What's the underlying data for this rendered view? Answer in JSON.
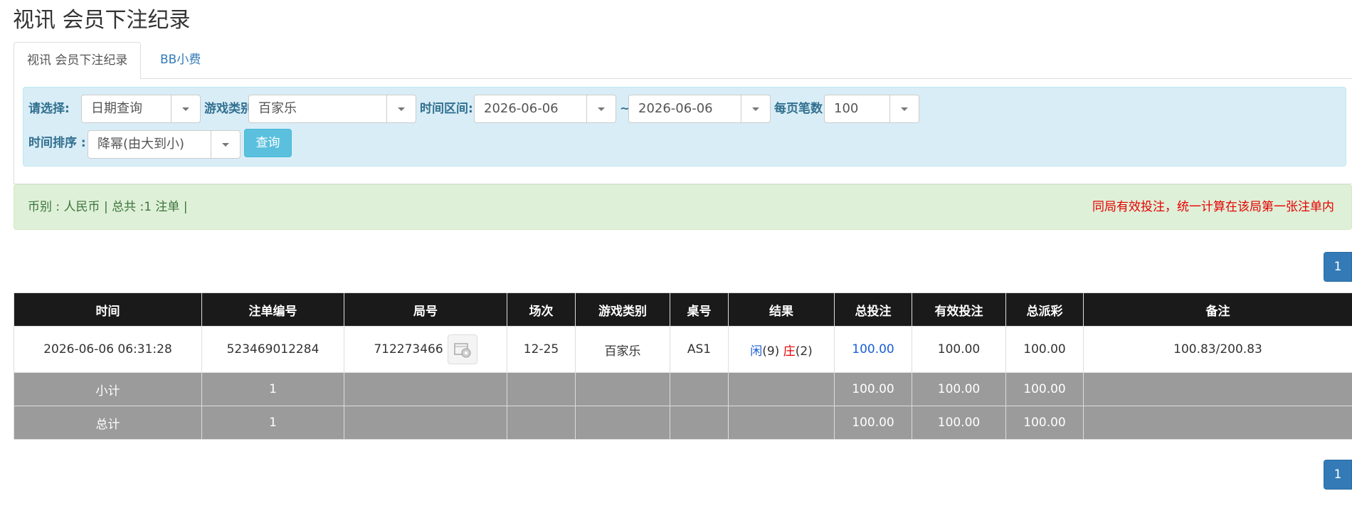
{
  "page": {
    "title": "视讯 会员下注纪录"
  },
  "tabs": [
    {
      "label": "视讯 会员下注纪录",
      "active": true
    },
    {
      "label": "BB小费",
      "active": false
    }
  ],
  "filters": {
    "select_label": "请选择:",
    "select_value": "日期查询",
    "game_type_label": "游戏类别",
    "game_type_value": "百家乐",
    "time_range_label": "时间区间:",
    "date_from": "2026-06-06",
    "tilde": "~",
    "date_to": "2026-06-06",
    "page_size_label": "每页笔数 :",
    "page_size_value": "100",
    "sort_label": "时间排序 :",
    "sort_value": "降幂(由大到小)",
    "query_button": "查询"
  },
  "summary": {
    "currency_info": "币别 : 人民币 | 总共 :1 注单 |",
    "notice": "同局有效投注，统一计算在该局第一张注单内"
  },
  "pagination": {
    "current_page": "1"
  },
  "table": {
    "headers": [
      "时间",
      "注单编号",
      "局号",
      "场次",
      "游戏类别",
      "桌号",
      "结果",
      "总投注",
      "有效投注",
      "总派彩",
      "备注"
    ],
    "rows": [
      {
        "time": "2026-06-06 06:31:28",
        "bet_no": "523469012284",
        "round_no": "712273466",
        "session": "12-25",
        "game_type": "百家乐",
        "table_no": "AS1",
        "result_player_label": "闲",
        "result_player_value": "(9)",
        "result_banker_label": "庄",
        "result_banker_value": "(2)",
        "total_bet": "100.00",
        "valid_bet": "100.00",
        "payout": "100.00",
        "remark": "100.83/200.83"
      }
    ],
    "subtotal": {
      "label": "小计",
      "count": "1",
      "total_bet": "100.00",
      "valid_bet": "100.00",
      "payout": "100.00"
    },
    "total": {
      "label": "总计",
      "count": "1",
      "total_bet": "100.00",
      "valid_bet": "100.00",
      "payout": "100.00"
    }
  },
  "colors": {
    "header_bg": "#1a1a1a",
    "summary_row_bg": "#9b9b9b",
    "filter_bg": "#d9edf7",
    "alert_bg": "#dff0d8",
    "notice_text": "#e60000",
    "primary": "#337ab7",
    "info_button": "#5bc0de"
  },
  "icons": {
    "round_video": "film-icon",
    "dropdown": "chevron-down-icon"
  }
}
